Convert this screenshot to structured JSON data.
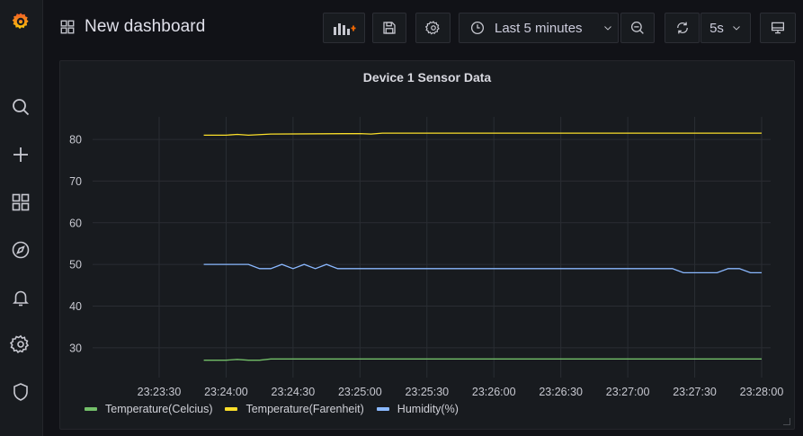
{
  "dashboard": {
    "title": "New dashboard"
  },
  "toolbar": {
    "time_range_label": "Last 5 minutes",
    "refresh_interval": "5s"
  },
  "sidebar": {
    "items": [
      {
        "icon": "grafana-logo-icon"
      },
      {
        "icon": "search-icon"
      },
      {
        "icon": "plus-icon"
      },
      {
        "icon": "dashboards-icon"
      },
      {
        "icon": "explore-compass-icon"
      },
      {
        "icon": "alerting-bell-icon"
      },
      {
        "icon": "configuration-gear-icon"
      },
      {
        "icon": "server-admin-shield-icon"
      }
    ]
  },
  "panel": {
    "title": "Device 1 Sensor Data"
  },
  "colors": {
    "temperature_celsius": "#73bf69",
    "temperature_fahrenheit": "#fade2a",
    "humidity": "#8ab8ff",
    "grafana_orange": "#f46800"
  },
  "chart_data": {
    "type": "line",
    "title": "Device 1 Sensor Data",
    "x_ticks": [
      "23:23:30",
      "23:24:00",
      "23:24:30",
      "23:25:00",
      "23:25:30",
      "23:26:00",
      "23:26:30",
      "23:27:00",
      "23:27:30",
      "23:28:00"
    ],
    "y_ticks": [
      30,
      40,
      50,
      60,
      70,
      80
    ],
    "ylim": [
      25,
      88
    ],
    "grid": true,
    "legend_position": "bottom-left",
    "series": [
      {
        "name": "Temperature(Celcius)",
        "color": "#73bf69",
        "points": [
          [
            "23:23:50",
            27.0
          ],
          [
            "23:24:00",
            27.0
          ],
          [
            "23:24:05",
            27.2
          ],
          [
            "23:24:10",
            27.0
          ],
          [
            "23:24:15",
            27.0
          ],
          [
            "23:24:20",
            27.3
          ],
          [
            "23:25:00",
            27.3
          ],
          [
            "23:26:00",
            27.3
          ],
          [
            "23:27:00",
            27.3
          ],
          [
            "23:28:00",
            27.3
          ]
        ]
      },
      {
        "name": "Temperature(Farenheit)",
        "color": "#fade2a",
        "points": [
          [
            "23:23:50",
            81.0
          ],
          [
            "23:24:00",
            81.0
          ],
          [
            "23:24:05",
            81.2
          ],
          [
            "23:24:10",
            81.0
          ],
          [
            "23:24:20",
            81.3
          ],
          [
            "23:25:00",
            81.4
          ],
          [
            "23:25:05",
            81.3
          ],
          [
            "23:25:10",
            81.5
          ],
          [
            "23:26:00",
            81.5
          ],
          [
            "23:27:00",
            81.5
          ],
          [
            "23:28:00",
            81.5
          ]
        ]
      },
      {
        "name": "Humidity(%)",
        "color": "#8ab8ff",
        "points": [
          [
            "23:23:50",
            50
          ],
          [
            "23:24:10",
            50
          ],
          [
            "23:24:15",
            49
          ],
          [
            "23:24:20",
            49
          ],
          [
            "23:24:25",
            50
          ],
          [
            "23:24:30",
            49
          ],
          [
            "23:24:35",
            50
          ],
          [
            "23:24:40",
            49
          ],
          [
            "23:24:45",
            50
          ],
          [
            "23:24:50",
            49
          ],
          [
            "23:25:00",
            49
          ],
          [
            "23:26:00",
            49
          ],
          [
            "23:27:00",
            49
          ],
          [
            "23:27:20",
            49
          ],
          [
            "23:27:25",
            48
          ],
          [
            "23:27:40",
            48
          ],
          [
            "23:27:45",
            49
          ],
          [
            "23:27:50",
            49
          ],
          [
            "23:27:55",
            48
          ],
          [
            "23:28:00",
            48
          ]
        ]
      }
    ]
  }
}
